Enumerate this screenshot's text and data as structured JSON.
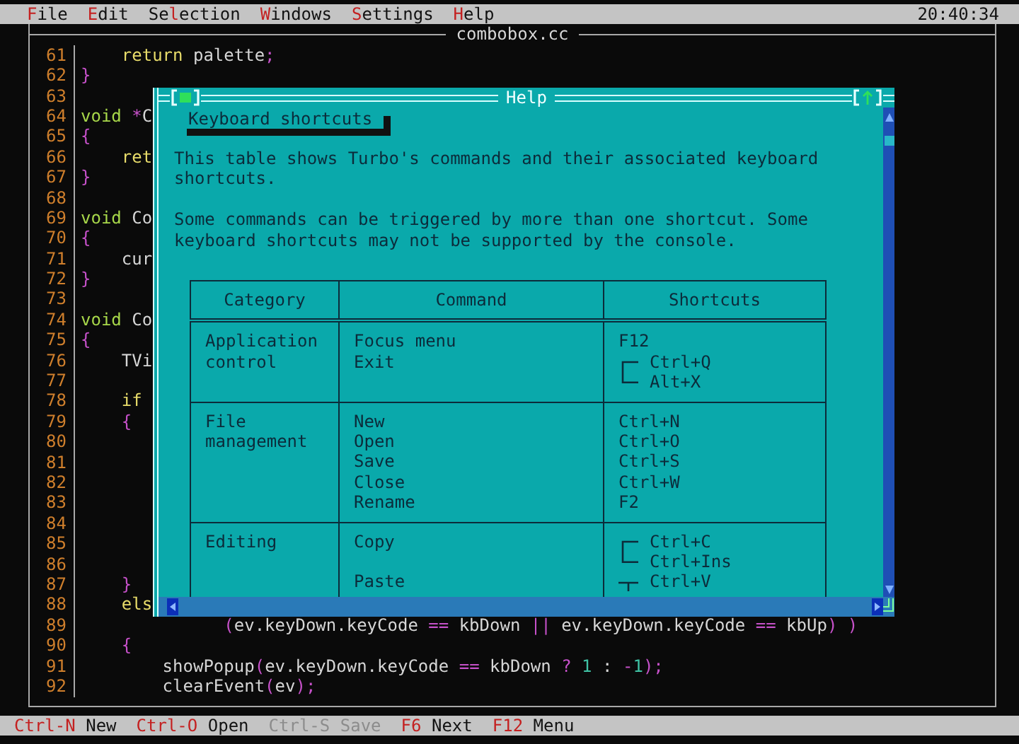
{
  "menu_bar": {
    "items": [
      {
        "key": "F",
        "post": "ile"
      },
      {
        "key": "E",
        "post": "dit"
      },
      {
        "pre": "Se",
        "key": "l",
        "post": "ection"
      },
      {
        "key": "W",
        "post": "indows"
      },
      {
        "key": "S",
        "post": "ettings"
      },
      {
        "key": "H",
        "post": "elp"
      }
    ],
    "clock": "20:40:34"
  },
  "editor": {
    "title": "combobox.cc",
    "lines": [
      {
        "number": "61",
        "tokens": [
          {
            "t": "    return",
            "kind": "kw"
          },
          {
            "t": " palette",
            "kind": "plain"
          },
          {
            "t": ";",
            "kind": "punct"
          }
        ]
      },
      {
        "number": "62",
        "tokens": [
          {
            "t": "}",
            "kind": "punct"
          }
        ]
      },
      {
        "number": "63"
      },
      {
        "number": "64",
        "tokens": [
          {
            "t": "void",
            "kind": "type"
          },
          {
            "t": " *",
            "kind": "punct"
          },
          {
            "t": "C",
            "kind": "plain"
          }
        ]
      },
      {
        "number": "65",
        "tokens": [
          {
            "t": "{",
            "kind": "punct"
          }
        ]
      },
      {
        "number": "66",
        "tokens": [
          {
            "t": "    ret",
            "kind": "kw"
          }
        ]
      },
      {
        "number": "67",
        "tokens": [
          {
            "t": "}",
            "kind": "punct"
          }
        ]
      },
      {
        "number": "68"
      },
      {
        "number": "69",
        "tokens": [
          {
            "t": "void",
            "kind": "type"
          },
          {
            "t": " Co",
            "kind": "plain"
          }
        ]
      },
      {
        "number": "70",
        "tokens": [
          {
            "t": "{",
            "kind": "punct"
          }
        ]
      },
      {
        "number": "71",
        "tokens": [
          {
            "t": "    cur",
            "kind": "plain"
          }
        ]
      },
      {
        "number": "72",
        "tokens": [
          {
            "t": "}",
            "kind": "punct"
          }
        ]
      },
      {
        "number": "73"
      },
      {
        "number": "74",
        "tokens": [
          {
            "t": "void",
            "kind": "type"
          },
          {
            "t": " Co",
            "kind": "plain"
          }
        ]
      },
      {
        "number": "75",
        "tokens": [
          {
            "t": "{",
            "kind": "punct"
          }
        ]
      },
      {
        "number": "76",
        "tokens": [
          {
            "t": "    TVi",
            "kind": "plain"
          }
        ]
      },
      {
        "number": "77"
      },
      {
        "number": "78",
        "tokens": [
          {
            "t": "    if",
            "kind": "kw"
          }
        ]
      },
      {
        "number": "79",
        "tokens": [
          {
            "t": "    {",
            "kind": "punct"
          }
        ]
      },
      {
        "number": "80"
      },
      {
        "number": "81"
      },
      {
        "number": "82"
      },
      {
        "number": "83"
      },
      {
        "number": "84"
      },
      {
        "number": "85"
      },
      {
        "number": "86"
      },
      {
        "number": "87",
        "tokens": [
          {
            "t": "    }",
            "kind": "punct"
          }
        ]
      },
      {
        "number": "88",
        "tokens": [
          {
            "t": "    els",
            "kind": "kw"
          }
        ]
      },
      {
        "number": "89",
        "tokens": [
          {
            "t": "              (",
            "kind": "punct"
          },
          {
            "t": "ev.keyDown.keyCode ",
            "kind": "plain"
          },
          {
            "t": "==",
            "kind": "punct"
          },
          {
            "t": " kbDown ",
            "kind": "plain"
          },
          {
            "t": "||",
            "kind": "punct"
          },
          {
            "t": " ev.keyDown.keyCode ",
            "kind": "plain"
          },
          {
            "t": "==",
            "kind": "punct"
          },
          {
            "t": " kbUp",
            "kind": "plain"
          },
          {
            "t": ") )",
            "kind": "punct"
          }
        ]
      },
      {
        "number": "90",
        "tokens": [
          {
            "t": "    {",
            "kind": "punct"
          }
        ]
      },
      {
        "number": "91",
        "tokens": [
          {
            "t": "        showPopup",
            "kind": "plain"
          },
          {
            "t": "(",
            "kind": "punct"
          },
          {
            "t": "ev.keyDown.keyCode ",
            "kind": "plain"
          },
          {
            "t": "==",
            "kind": "punct"
          },
          {
            "t": " kbDown ",
            "kind": "plain"
          },
          {
            "t": "? ",
            "kind": "punct"
          },
          {
            "t": "1",
            "kind": "num"
          },
          {
            "t": " : ",
            "kind": "plain"
          },
          {
            "t": "-",
            "kind": "punct"
          },
          {
            "t": "1",
            "kind": "num"
          },
          {
            "t": ");",
            "kind": "punct"
          }
        ]
      },
      {
        "number": "92",
        "tokens": [
          {
            "t": "        clearEvent",
            "kind": "plain"
          },
          {
            "t": "(",
            "kind": "punct"
          },
          {
            "t": "ev",
            "kind": "plain"
          },
          {
            "t": ");",
            "kind": "punct"
          }
        ]
      }
    ]
  },
  "help_window": {
    "title": "Help",
    "heading": "Keyboard shortcuts",
    "paragraphs": [
      "This table shows Turbo's commands and their associated keyboard shortcuts.",
      "Some commands can be triggered by more than one shortcut. Some keyboard shortcuts may not be supported by the console."
    ],
    "table": {
      "columns": [
        "Category",
        "Command",
        "Shortcuts"
      ],
      "rows": [
        {
          "category": "Application control",
          "commands": [
            {
              "command": "Focus menu",
              "grouped": false,
              "shortcuts": [
                "F12"
              ]
            },
            {
              "command": "Exit",
              "grouped": true,
              "shortcuts": [
                "Ctrl+Q",
                "Alt+X"
              ]
            }
          ]
        },
        {
          "category": "File management",
          "commands": [
            {
              "command": "New",
              "grouped": false,
              "shortcuts": [
                "Ctrl+N"
              ]
            },
            {
              "command": "Open",
              "grouped": false,
              "shortcuts": [
                "Ctrl+O"
              ]
            },
            {
              "command": "Save",
              "grouped": false,
              "shortcuts": [
                "Ctrl+S"
              ]
            },
            {
              "command": "Close",
              "grouped": false,
              "shortcuts": [
                "Ctrl+W"
              ]
            },
            {
              "command": "Rename",
              "grouped": false,
              "shortcuts": [
                "F2"
              ]
            }
          ]
        },
        {
          "category": "Editing",
          "commands": [
            {
              "command": "Copy",
              "grouped": true,
              "shortcuts": [
                "Ctrl+C",
                "Ctrl+Ins"
              ]
            },
            {
              "command": "Paste",
              "grouped": true,
              "shortcuts": [
                "Ctrl+V"
              ]
            }
          ]
        }
      ]
    }
  },
  "status_bar": [
    {
      "key": "Ctrl-N",
      "label": "New",
      "disabled": false
    },
    {
      "key": "Ctrl-O",
      "label": "Open",
      "disabled": false
    },
    {
      "key": "Ctrl-S",
      "label": "Save",
      "disabled": true
    },
    {
      "key": "F6",
      "label": "Next",
      "disabled": false
    },
    {
      "key": "F12",
      "label": "Menu",
      "disabled": false
    }
  ]
}
